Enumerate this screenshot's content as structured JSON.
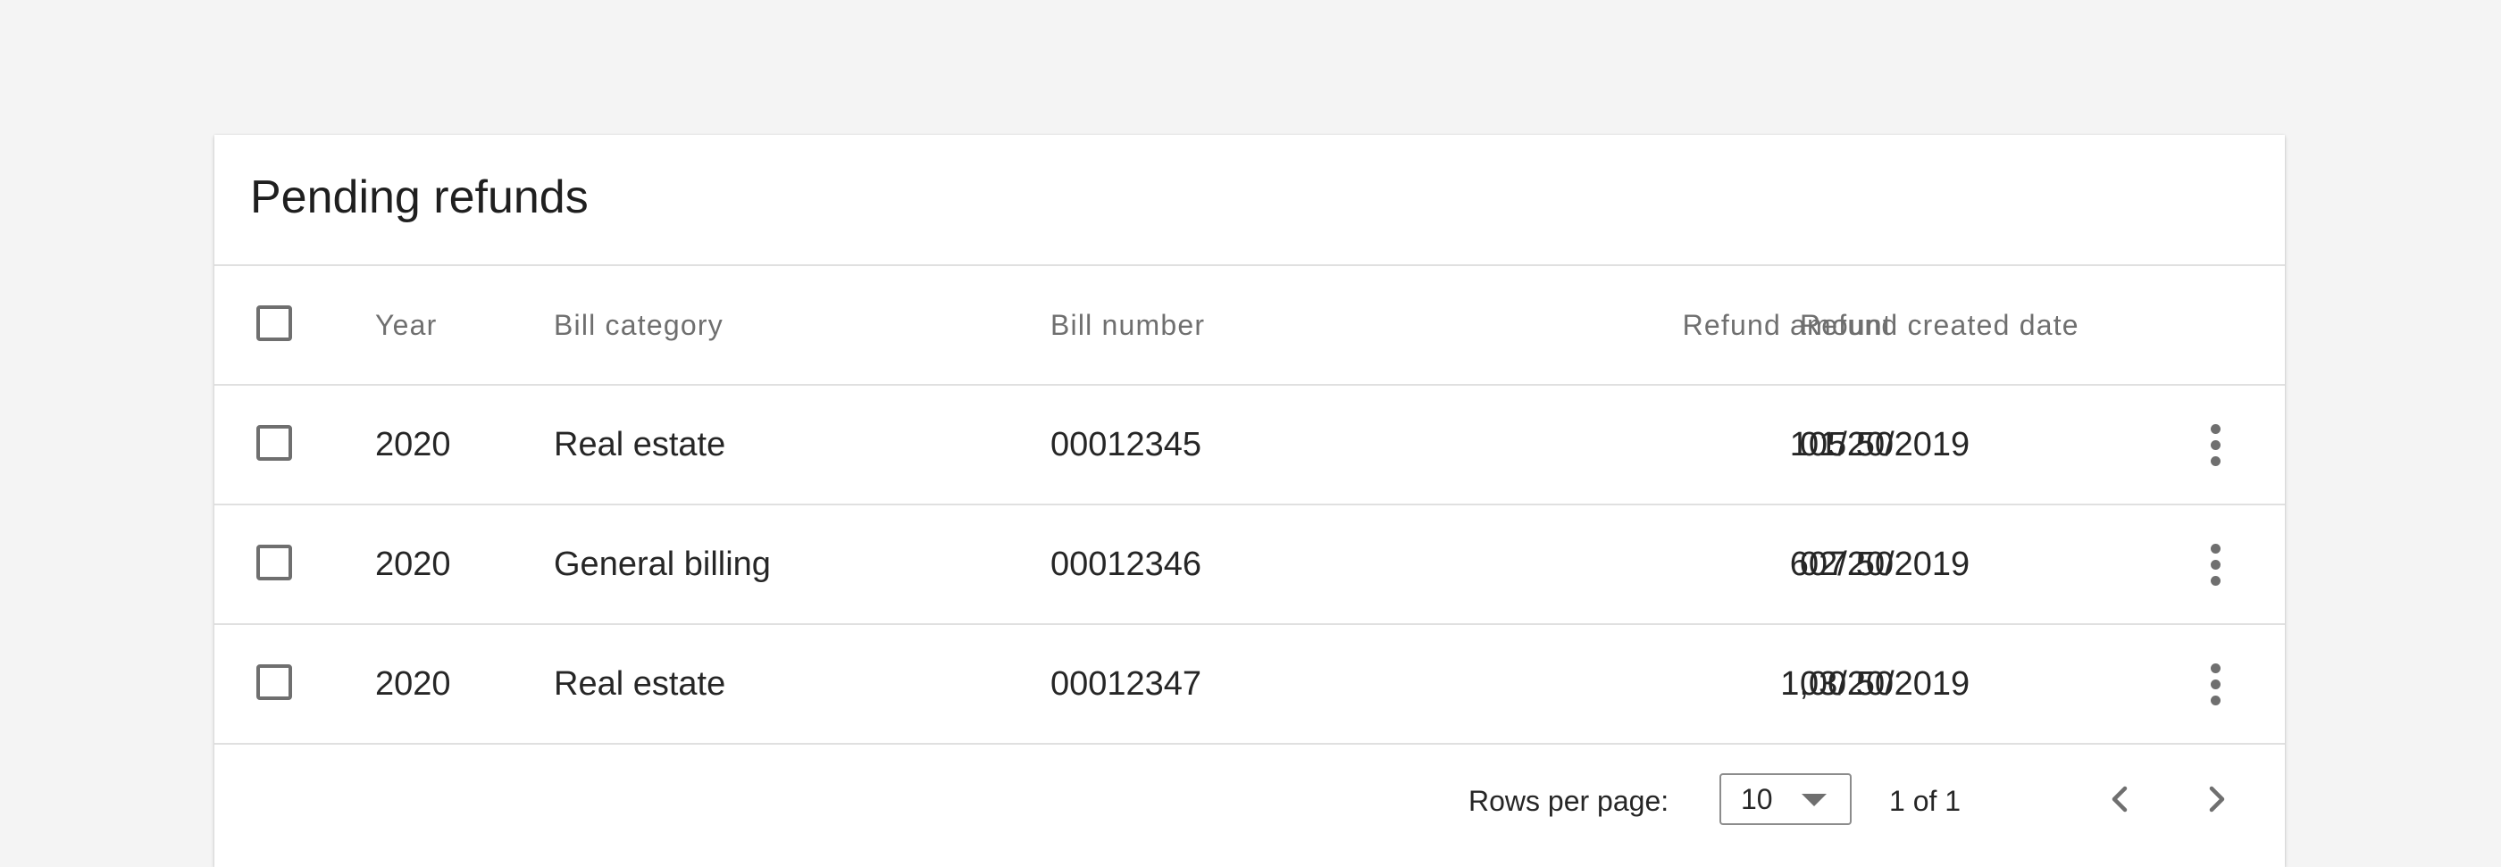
{
  "card": {
    "title": "Pending refunds"
  },
  "table": {
    "columns": {
      "year": "Year",
      "bill_category": "Bill category",
      "bill_number": "Bill number",
      "refund_amount": "Refund amount",
      "refund_created_date": "Refund created date"
    },
    "rows": [
      {
        "year": "2020",
        "bill_category": "Real estate",
        "bill_number": "00012345",
        "refund_amount": "105.50",
        "refund_created_date": "01/20/2019"
      },
      {
        "year": "2020",
        "bill_category": "General billing",
        "bill_number": "00012346",
        "refund_amount": "607.50",
        "refund_created_date": "02/20/2019"
      },
      {
        "year": "2020",
        "bill_category": "Real estate",
        "bill_number": "00012347",
        "refund_amount": "1,00.50",
        "refund_created_date": "03/20/2019"
      }
    ]
  },
  "pagination": {
    "rows_per_page_label": "Rows per page:",
    "rows_per_page_value": "10",
    "page_status": "1 of 1",
    "prev_icon": "chevron-left-icon",
    "next_icon": "chevron-right-icon"
  },
  "colors": {
    "background": "#f4f4f4",
    "card": "#ffffff",
    "divider": "#e0e0e0",
    "text": "#262626",
    "header_text": "#6f6f6f"
  }
}
